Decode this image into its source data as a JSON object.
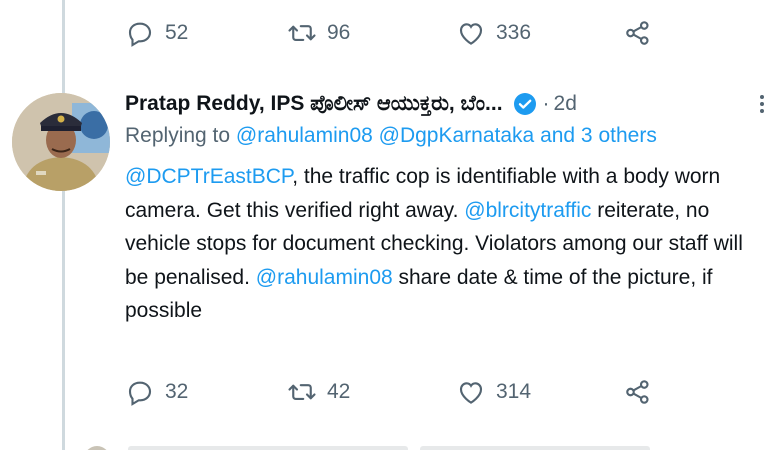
{
  "top_tweet": {
    "actions": {
      "reply_count": "52",
      "retweet_count": "96",
      "like_count": "336"
    }
  },
  "tweet": {
    "author": "Pratap Reddy, IPS ಪೊಲೀಸ್ ಆಯುಕ್ತರು, ಬೆಂ...",
    "dot": "·",
    "time": "2d",
    "replying": {
      "prefix": "Replying to ",
      "user1": "@rahulamin08",
      "user2": "@DgpKarnataka",
      "and_others": "and 3 others"
    },
    "body": {
      "mention1": "@DCPTrEastBCP",
      "text1": ", the traffic cop is identifiable with a body worn camera. Get this verified right away. ",
      "mention2": "@blrcitytraffic",
      "text2": " reiterate, no vehicle stops for document checking. Violators among our staff will be penalised. ",
      "mention3": "@rahulamin08",
      "text3": " share date & time of the picture, if possible"
    },
    "actions": {
      "reply_count": "32",
      "retweet_count": "42",
      "like_count": "314"
    }
  },
  "colors": {
    "accent": "#1d9bf0",
    "secondary_text": "#536471",
    "primary_text": "#0f1419",
    "thread_line": "#cfd9de"
  },
  "icons": [
    "reply-icon",
    "retweet-icon",
    "like-icon",
    "share-icon",
    "verified-icon",
    "more-icon"
  ]
}
